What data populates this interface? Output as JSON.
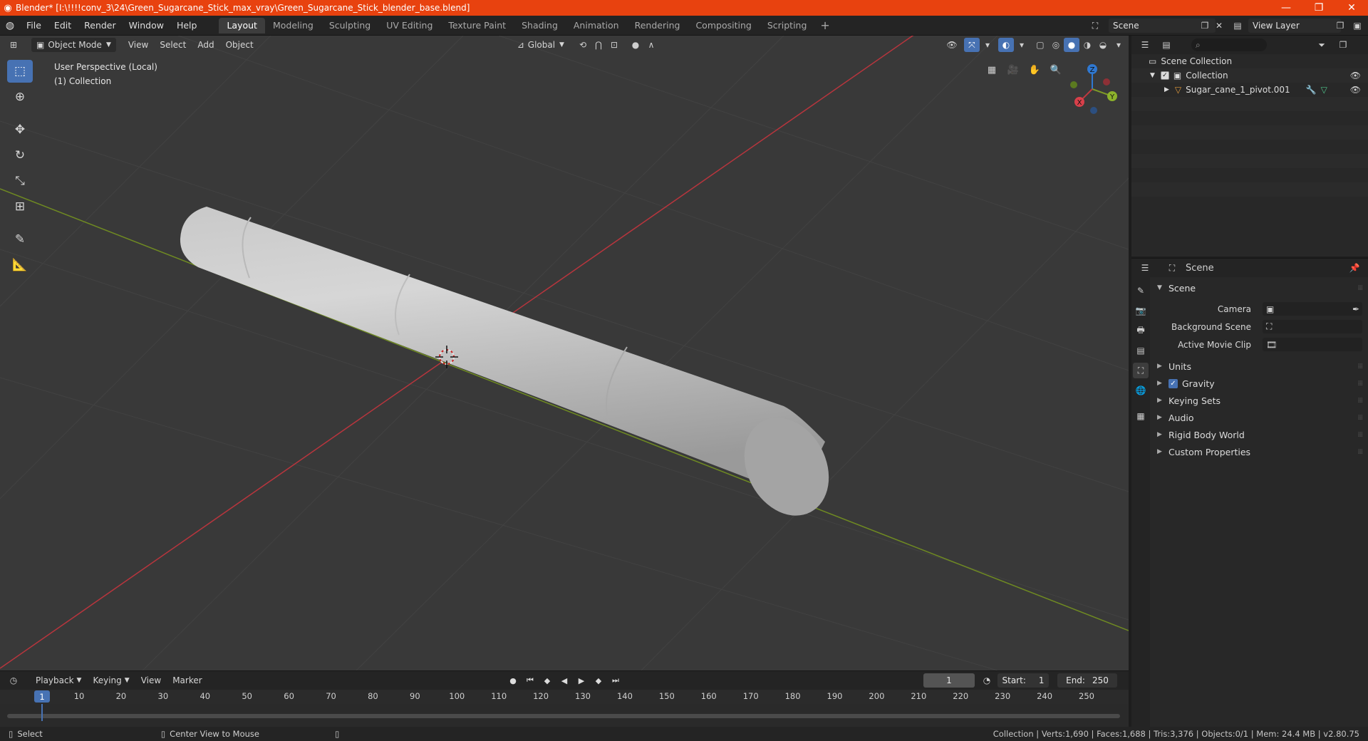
{
  "window": {
    "title": "Blender* [I:\\!!!!conv_3\\24\\Green_Sugarcane_Stick_max_vray\\Green_Sugarcane_Stick_blender_base.blend]"
  },
  "menu": [
    "File",
    "Edit",
    "Render",
    "Window",
    "Help"
  ],
  "workspaces": [
    "Layout",
    "Modeling",
    "Sculpting",
    "UV Editing",
    "Texture Paint",
    "Shading",
    "Animation",
    "Rendering",
    "Compositing",
    "Scripting"
  ],
  "active_workspace": "Layout",
  "scene_name": "Scene",
  "view_layer": "View Layer",
  "viewport": {
    "mode": "Object Mode",
    "menus": [
      "View",
      "Select",
      "Add",
      "Object"
    ],
    "orientation": "Global",
    "info_line1": "User Perspective (Local)",
    "info_line2": "(1) Collection",
    "gizmo_labels": {
      "x": "X",
      "y": "Y",
      "z": "Z"
    }
  },
  "outliner": {
    "root": "Scene Collection",
    "collection": "Collection",
    "object": "Sugar_cane_1_pivot.001"
  },
  "properties": {
    "header": "Scene",
    "panel": "Scene",
    "rows": [
      {
        "label": "Camera",
        "value": ""
      },
      {
        "label": "Background Scene",
        "value": ""
      },
      {
        "label": "Active Movie Clip",
        "value": ""
      }
    ],
    "subpanels": [
      "Units",
      "Gravity",
      "Keying Sets",
      "Audio",
      "Rigid Body World",
      "Custom Properties"
    ]
  },
  "timeline": {
    "menus": [
      "Playback",
      "Keying",
      "View",
      "Marker"
    ],
    "current_frame": "1",
    "start_label": "Start:",
    "start": "1",
    "end_label": "End:",
    "end": "250",
    "ticks": [
      "1",
      "10",
      "20",
      "30",
      "40",
      "50",
      "60",
      "70",
      "80",
      "90",
      "100",
      "110",
      "120",
      "130",
      "140",
      "150",
      "160",
      "170",
      "180",
      "190",
      "200",
      "210",
      "220",
      "230",
      "240",
      "250"
    ]
  },
  "status": {
    "select": "Select",
    "center_view": "Center View to Mouse",
    "stats": "Collection | Verts:1,690 | Faces:1,688 | Tris:3,376 | Objects:0/1 | Mem: 24.4 MB | v2.80.75"
  },
  "colors": {
    "accent": "#4772b3",
    "titlebar": "#e8420f",
    "axis_x": "#c0393f",
    "axis_y": "#7e9a27",
    "axis_z": "#2f78d1"
  }
}
